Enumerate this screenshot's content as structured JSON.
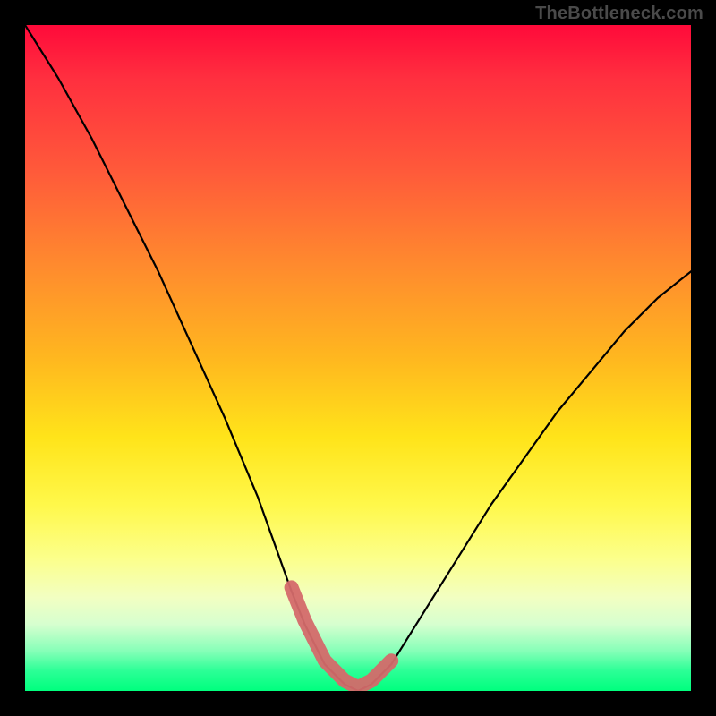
{
  "watermark": {
    "text": "TheBottleneck.com"
  },
  "chart_data": {
    "type": "line",
    "title": "",
    "xlabel": "",
    "ylabel": "",
    "xlim": [
      0,
      100
    ],
    "ylim": [
      0,
      100
    ],
    "grid": false,
    "legend": false,
    "series": [
      {
        "name": "bottleneck-curve",
        "x": [
          0,
          5,
          10,
          15,
          20,
          25,
          30,
          35,
          40,
          42,
          45,
          48,
          50,
          52,
          55,
          60,
          65,
          70,
          75,
          80,
          85,
          90,
          95,
          100
        ],
        "values": [
          100,
          92,
          83,
          73,
          63,
          52,
          41,
          29,
          15,
          10,
          4,
          1,
          0,
          1,
          4,
          12,
          20,
          28,
          35,
          42,
          48,
          54,
          59,
          63
        ]
      }
    ],
    "optimal_range": {
      "x_start": 40,
      "x_end": 56,
      "y": 2
    },
    "background_gradient": {
      "stops": [
        {
          "pos": 0.0,
          "color": "#ff0a3a"
        },
        {
          "pos": 0.5,
          "color": "#ffe41a"
        },
        {
          "pos": 0.8,
          "color": "#fcff8a"
        },
        {
          "pos": 1.0,
          "color": "#00ff7e"
        }
      ]
    },
    "colors": {
      "curve": "#000000",
      "highlight": "#d46a6a",
      "frame": "#000000"
    }
  }
}
